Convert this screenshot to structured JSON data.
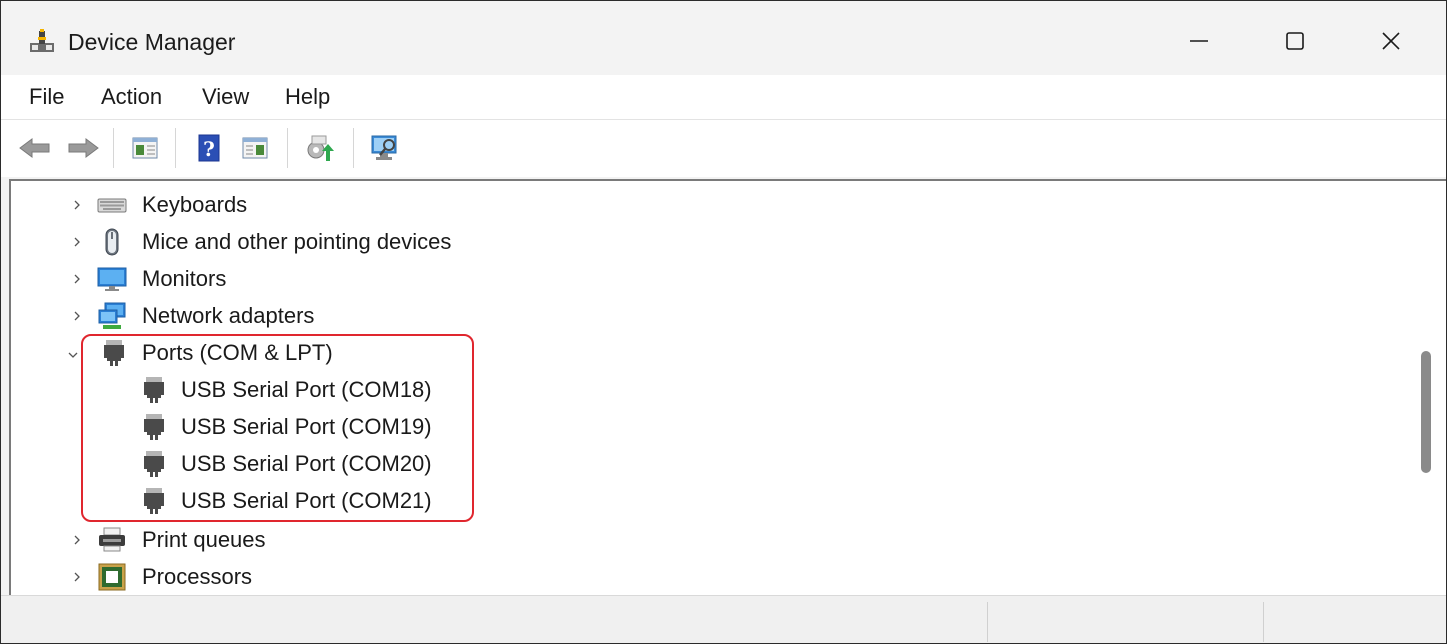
{
  "window": {
    "title": "Device Manager",
    "controls": {
      "minimize": "minimize",
      "maximize": "maximize",
      "close": "close"
    }
  },
  "menu": {
    "items": [
      "File",
      "Action",
      "View",
      "Help"
    ]
  },
  "toolbar": {
    "buttons": [
      {
        "icon": "back-arrow-icon"
      },
      {
        "icon": "forward-arrow-icon"
      },
      {
        "icon": "show-hide-console-tree-icon"
      },
      {
        "icon": "help-icon"
      },
      {
        "icon": "show-hide-action-pane-icon"
      },
      {
        "icon": "update-driver-icon"
      },
      {
        "icon": "scan-for-hardware-changes-icon"
      }
    ]
  },
  "tree": {
    "nodes": [
      {
        "label": "Keyboards",
        "expanded": false,
        "icon": "keyboard-icon"
      },
      {
        "label": "Mice and other pointing devices",
        "expanded": false,
        "icon": "mouse-icon"
      },
      {
        "label": "Monitors",
        "expanded": false,
        "icon": "monitor-icon"
      },
      {
        "label": "Network adapters",
        "expanded": false,
        "icon": "network-adapter-icon"
      },
      {
        "label": "Ports (COM & LPT)",
        "expanded": true,
        "icon": "port-icon",
        "children": [
          {
            "label": "USB Serial Port (COM18)",
            "icon": "port-icon"
          },
          {
            "label": "USB Serial Port (COM19)",
            "icon": "port-icon"
          },
          {
            "label": "USB Serial Port (COM20)",
            "icon": "port-icon"
          },
          {
            "label": "USB Serial Port (COM21)",
            "icon": "port-icon"
          }
        ]
      },
      {
        "label": "Print queues",
        "expanded": false,
        "icon": "printer-icon"
      },
      {
        "label": "Processors",
        "expanded": false,
        "icon": "processor-icon"
      }
    ]
  },
  "colors": {
    "highlight": "#e0262e",
    "title_bar": "#f3f3f3",
    "tree_background": "#ffffff"
  }
}
